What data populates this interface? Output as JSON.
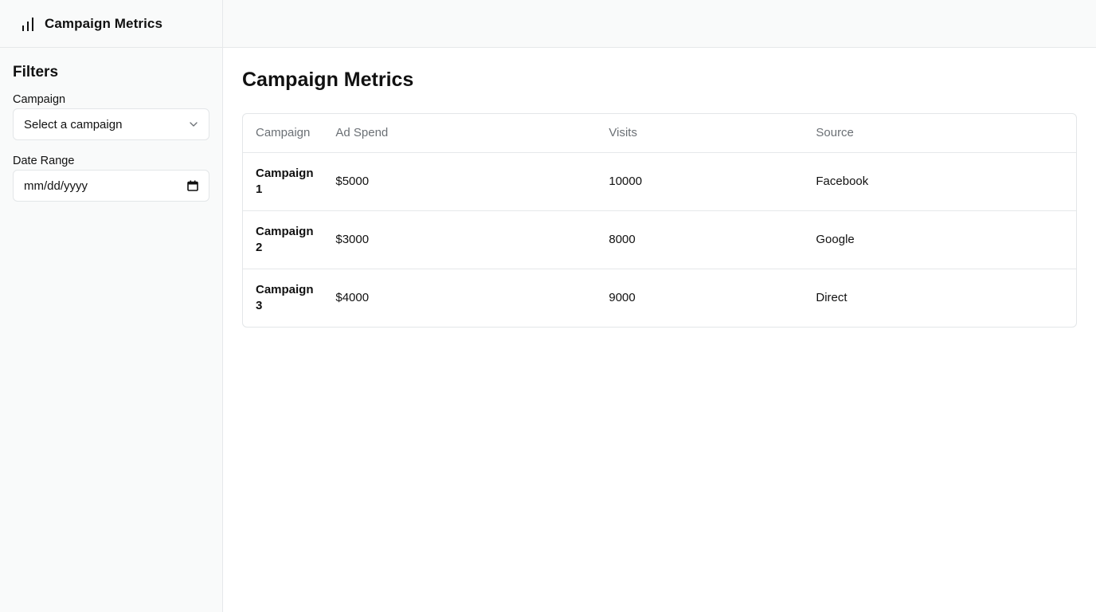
{
  "app": {
    "title": "Campaign Metrics",
    "icon": "bar-chart-icon"
  },
  "sidebar": {
    "filters_title": "Filters",
    "campaign": {
      "label": "Campaign",
      "value": "Select a campaign",
      "icon": "chevron-down-icon"
    },
    "date_range": {
      "label": "Date Range",
      "placeholder": "mm/dd/yyyy",
      "icon": "calendar-icon"
    }
  },
  "main": {
    "title": "Campaign Metrics",
    "table": {
      "headers": [
        "Campaign",
        "Ad Spend",
        "Visits",
        "Source"
      ],
      "rows": [
        {
          "campaign": "Campaign 1",
          "ad_spend": "$5000",
          "visits": "10000",
          "source": "Facebook"
        },
        {
          "campaign": "Campaign 2",
          "ad_spend": "$3000",
          "visits": "8000",
          "source": "Google"
        },
        {
          "campaign": "Campaign 3",
          "ad_spend": "$4000",
          "visits": "9000",
          "source": "Direct"
        }
      ]
    }
  }
}
